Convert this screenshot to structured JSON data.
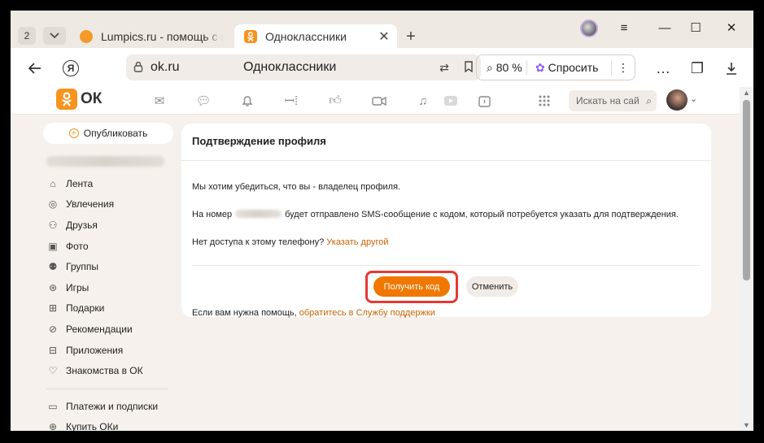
{
  "browser": {
    "tab_count": "2",
    "tabs": [
      {
        "title": "Lumpics.ru - помощь с ком"
      },
      {
        "title": "Одноклассники"
      }
    ],
    "address": {
      "url": "ok.ru",
      "page_title": "Одноклассники"
    },
    "zoom": "80 %",
    "ask_label": "Спросить"
  },
  "site": {
    "logo_text": "ОК",
    "logo_badge": "ok",
    "search_placeholder": "Искать на сайте",
    "nav_icons": [
      "mail-icon",
      "chat-icon",
      "bell-icon",
      "guests-icon",
      "likes-icon",
      "video-icon",
      "music-icon",
      "video-play-icon",
      "calendar-icon",
      "grid-icon"
    ]
  },
  "sidebar": {
    "publish_label": "Опубликовать",
    "items": [
      {
        "label": "Лента",
        "icon": "feed-icon"
      },
      {
        "label": "Увлечения",
        "icon": "hobby-icon"
      },
      {
        "label": "Друзья",
        "icon": "friends-icon"
      },
      {
        "label": "Фото",
        "icon": "photo-icon"
      },
      {
        "label": "Группы",
        "icon": "groups-icon"
      },
      {
        "label": "Игры",
        "icon": "games-icon"
      },
      {
        "label": "Подарки",
        "icon": "gift-icon"
      },
      {
        "label": "Рекомендации",
        "icon": "recommend-icon"
      },
      {
        "label": "Приложения",
        "icon": "apps-icon"
      },
      {
        "label": "Знакомства в ОК",
        "icon": "dating-icon"
      }
    ],
    "items2": [
      {
        "label": "Платежи и подписки",
        "icon": "wallet-icon"
      },
      {
        "label": "Купить ОКи",
        "icon": "coin-icon"
      }
    ]
  },
  "card": {
    "title": "Подтверждение профиля",
    "line1": "Мы хотим убедиться, что вы - владелец профиля.",
    "line2_prefix": "На номер",
    "line2_suffix": "будет отправлено SMS-сообщение с кодом, который потребуется указать для подтверждения.",
    "line3_prefix": "Нет доступа к этому телефону?",
    "line3_link": "Указать другой",
    "get_code_label": "Получить код",
    "cancel_label": "Отменить",
    "help_prefix": "Если вам нужна помощь,",
    "help_link": "обратитесь в Службу поддержки"
  },
  "colors": {
    "brand_orange": "#f7931e",
    "button_orange": "#f07800",
    "link_orange": "#c76300",
    "highlight_red": "#e53935"
  }
}
